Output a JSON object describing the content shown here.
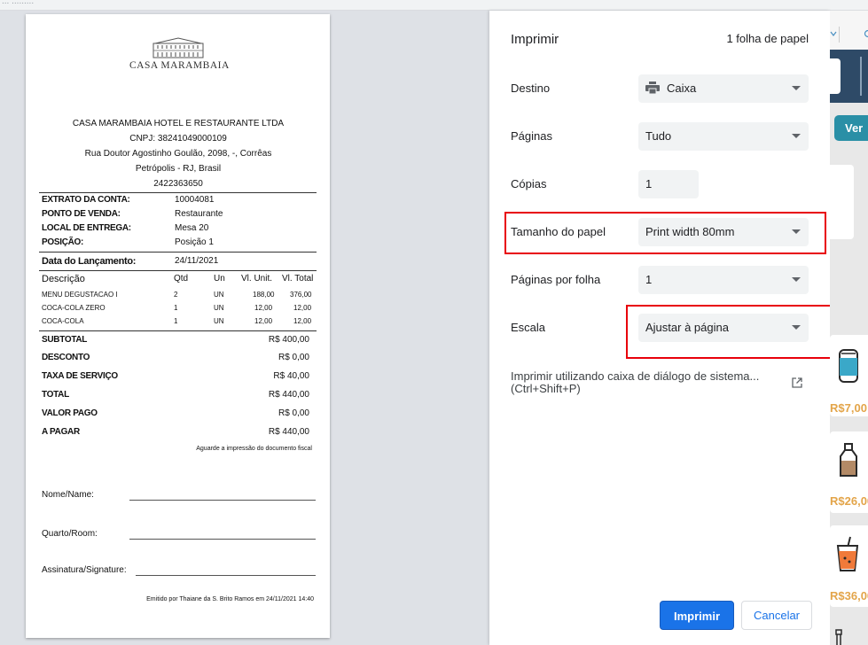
{
  "top_strip": {
    "text": "... ........."
  },
  "receipt": {
    "logo_text": "CASA MARAMBAIA",
    "company": "CASA MARAMBAIA HOTEL E RESTAURANTE LTDA",
    "cnpj": "CNPJ: 38241049000109",
    "address": "Rua Doutor Agostinho Goulão, 2098, -, Corrêas",
    "city": "Petrópolis - RJ, Brasil",
    "phone": "2422363650",
    "fields": [
      {
        "label": "EXTRATO DA CONTA:",
        "value": "10004081"
      },
      {
        "label": "PONTO DE VENDA:",
        "value": "Restaurante"
      },
      {
        "label": "LOCAL DE ENTREGA:",
        "value": "Mesa 20"
      },
      {
        "label": "POSIÇÃO:",
        "value": "Posição 1"
      }
    ],
    "date_label": "Data do Lançamento:",
    "date_value": "24/11/2021",
    "columns": {
      "desc": "Descrição",
      "qtd": "Qtd",
      "un": "Un",
      "unit": "Vl. Unit.",
      "total": "Vl. Total"
    },
    "items": [
      {
        "desc": "MENU DEGUSTACAO I",
        "qtd": "2",
        "un": "UN",
        "unit": "188,00",
        "total": "376,00"
      },
      {
        "desc": "COCA-COLA ZERO",
        "qtd": "1",
        "un": "UN",
        "unit": "12,00",
        "total": "12,00"
      },
      {
        "desc": "COCA-COLA",
        "qtd": "1",
        "un": "UN",
        "unit": "12,00",
        "total": "12,00"
      }
    ],
    "totals": [
      {
        "label": "SUBTOTAL",
        "value": "R$ 400,00"
      },
      {
        "label": "DESCONTO",
        "value": "R$ 0,00"
      },
      {
        "label": "TAXA DE SERVIÇO",
        "value": "R$ 40,00"
      },
      {
        "label": "TOTAL",
        "value": "R$ 440,00"
      },
      {
        "label": "VALOR PAGO",
        "value": "R$ 0,00"
      },
      {
        "label": "A PAGAR",
        "value": "R$ 440,00"
      }
    ],
    "note": "Aguarde a impressão do documento fiscal",
    "signature_fields": [
      "Nome/Name:",
      "Quarto/Room:",
      "Assinatura/Signature:"
    ],
    "emitted": "Emitido por Thaiane da S. Brito Ramos em 24/11/2021 14:40"
  },
  "dialog": {
    "title": "Imprimir",
    "sheet_count": "1 folha de papel",
    "destination": {
      "label": "Destino",
      "value": "Caixa"
    },
    "pages": {
      "label": "Páginas",
      "value": "Tudo"
    },
    "copies": {
      "label": "Cópias",
      "value": "1"
    },
    "paper_size": {
      "label": "Tamanho do papel",
      "value": "Print width 80mm"
    },
    "pages_per_sheet": {
      "label": "Páginas por folha",
      "value": "1"
    },
    "scale": {
      "label": "Escala",
      "value": "Ajustar à página"
    },
    "system_dialog_line1": "Imprimir utilizando caixa de diálogo de sistema...",
    "system_dialog_line2": "(Ctrl+Shift+P)",
    "print_button": "Imprimir",
    "cancel_button": "Cancelar",
    "highlight_color": "#e8000b",
    "accent_color": "#1a73e8"
  },
  "right_app": {
    "ver_button": "Ver",
    "prices": [
      "R$7,00",
      "R$26,00",
      "R$36,00"
    ]
  }
}
